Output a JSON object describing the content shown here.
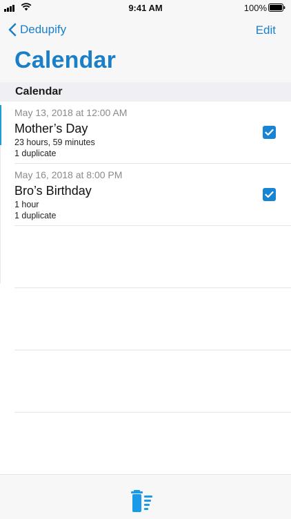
{
  "status_bar": {
    "time": "9:41 AM",
    "battery_percent": "100%",
    "battery_level": 1.0
  },
  "nav": {
    "back_label": "Dedupify",
    "edit_label": "Edit",
    "title": "Calendar"
  },
  "section": {
    "header": "Calendar"
  },
  "events": [
    {
      "date": "May 13, 2018 at 12:00 AM",
      "title": "Mother’s Day",
      "duration": "23 hours, 59 minutes",
      "duplicates": "1 duplicate",
      "checked": true
    },
    {
      "date": "May 16, 2018 at 8:00 PM",
      "title": "Bro’s Birthday",
      "duration": "1 hour",
      "duplicates": "1 duplicate",
      "checked": true
    }
  ],
  "toolbar": {
    "icon": "trash-list-icon"
  },
  "colors": {
    "accent": "#1a7fc7",
    "checkbox": "#1a84d4",
    "section_bg": "#efeff4"
  }
}
